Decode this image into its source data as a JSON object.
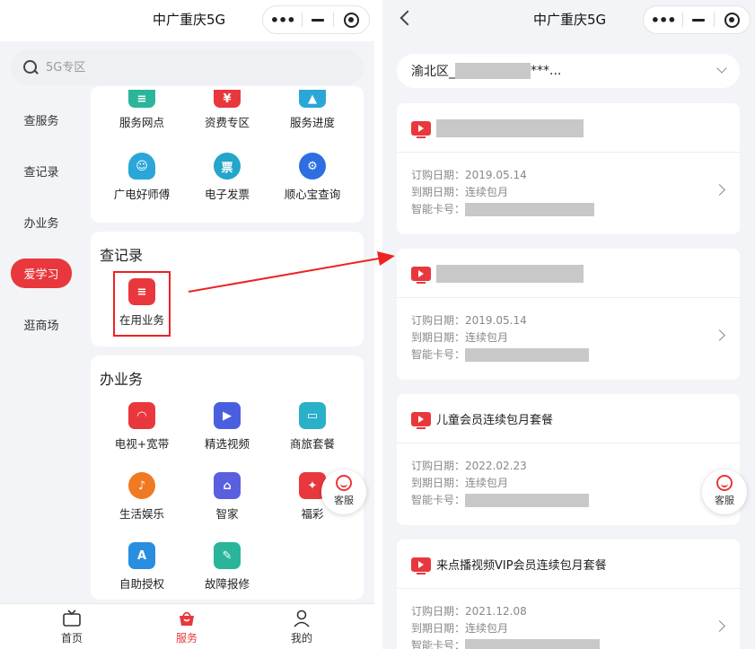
{
  "left": {
    "header": {
      "title": "中广重庆5G"
    },
    "search": {
      "placeholder": "5G专区"
    },
    "sidebar": {
      "items": [
        {
          "label": "查服务"
        },
        {
          "label": "查记录"
        },
        {
          "label": "办业务"
        },
        {
          "label": "爱学习",
          "active": true
        },
        {
          "label": "逛商场"
        }
      ]
    },
    "service_card": {
      "tiles": [
        {
          "label": "服务网点",
          "icon": "store-icon",
          "color": "#2bb59a"
        },
        {
          "label": "资费专区",
          "icon": "price-tag-icon",
          "color": "#e8383d"
        },
        {
          "label": "服务进度",
          "icon": "progress-icon",
          "color": "#2aa7d8"
        },
        {
          "label": "广电好师傅",
          "icon": "technician-icon",
          "color": "#2aa7d8"
        },
        {
          "label": "电子发票",
          "icon": "invoice-icon",
          "color": "#22a6c9"
        },
        {
          "label": "顺心宝查询",
          "icon": "gear-icon",
          "color": "#2d6fe0"
        }
      ]
    },
    "records_card": {
      "title": "查记录",
      "tiles": [
        {
          "label": "在用业务",
          "icon": "active-business-icon",
          "color": "#e8383d"
        }
      ]
    },
    "business_card": {
      "title": "办业务",
      "tiles": [
        {
          "label": "电视+宽带",
          "icon": "wifi-tv-icon",
          "color": "#e8383d"
        },
        {
          "label": "精选视频",
          "icon": "video-play-icon",
          "color": "#4a5fe0"
        },
        {
          "label": "商旅套餐",
          "icon": "suitcase-icon",
          "color": "#2ab0c8"
        },
        {
          "label": "生活娱乐",
          "icon": "microphone-icon",
          "color": "#f07a22"
        },
        {
          "label": "智家",
          "icon": "smart-home-icon",
          "color": "#5a5fe0"
        },
        {
          "label": "福彩",
          "icon": "lottery-icon",
          "color": "#e8383d"
        },
        {
          "label": "自助授权",
          "icon": "authorize-icon",
          "color": "#2a8ee0"
        },
        {
          "label": "故障报修",
          "icon": "wrench-icon",
          "color": "#2ab59a"
        }
      ]
    },
    "float_service": {
      "label": "客服"
    },
    "tabbar": {
      "tabs": [
        {
          "label": "首页",
          "icon": "tv-icon"
        },
        {
          "label": "服务",
          "icon": "service-bag-icon",
          "active": true
        },
        {
          "label": "我的",
          "icon": "user-icon"
        }
      ]
    }
  },
  "right": {
    "header": {
      "title": "中广重庆5G"
    },
    "region": {
      "prefix": "渝北区_",
      "suffix": "***..."
    },
    "orders": [
      {
        "name": "",
        "purchase_label": "订购日期：",
        "purchase_date": "2019.05.14",
        "expire_label": "到期日期：",
        "expire_value": "连续包月",
        "card_label": "智能卡号："
      },
      {
        "name": "",
        "purchase_label": "订购日期：",
        "purchase_date": "2019.05.14",
        "expire_label": "到期日期：",
        "expire_value": "连续包月",
        "card_label": "智能卡号："
      },
      {
        "name": "儿童会员连续包月套餐",
        "purchase_label": "订购日期：",
        "purchase_date": "2022.02.23",
        "expire_label": "到期日期：",
        "expire_value": "连续包月",
        "card_label": "智能卡号："
      },
      {
        "name": "来点播视频VIP会员连续包月套餐",
        "purchase_label": "订购日期：",
        "purchase_date": "2021.12.08",
        "expire_label": "到期日期：",
        "expire_value": "连续包月",
        "card_label": "智能卡号："
      }
    ],
    "float_service": {
      "label": "客服"
    }
  },
  "colors": {
    "accent": "#e8383d",
    "annotation": "#e22222"
  }
}
